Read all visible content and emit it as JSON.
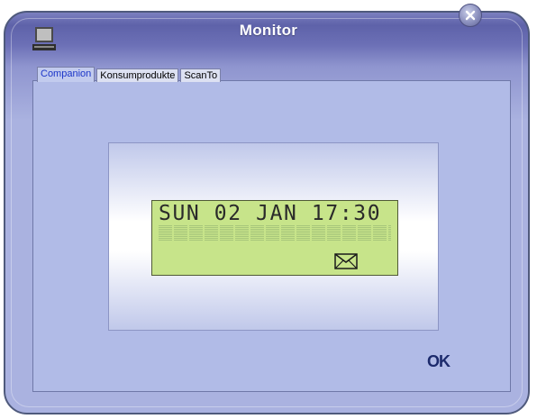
{
  "window": {
    "title": "Monitor"
  },
  "icons": {
    "app": "monitor-icon",
    "close": "close-icon",
    "mail": "envelope-icon"
  },
  "tabs": [
    {
      "label": "Companion",
      "active": true
    },
    {
      "label": "Konsumprodukte",
      "active": false
    },
    {
      "label": "ScanTo",
      "active": false
    }
  ],
  "lcd": {
    "line1": "SUN 02 JAN 17:30",
    "line2": ""
  },
  "buttons": {
    "ok": "OK"
  },
  "colors": {
    "lcd_background": "#c7e48a",
    "active_tab_text": "#1b35c8",
    "panel": "#b1bbe7"
  }
}
